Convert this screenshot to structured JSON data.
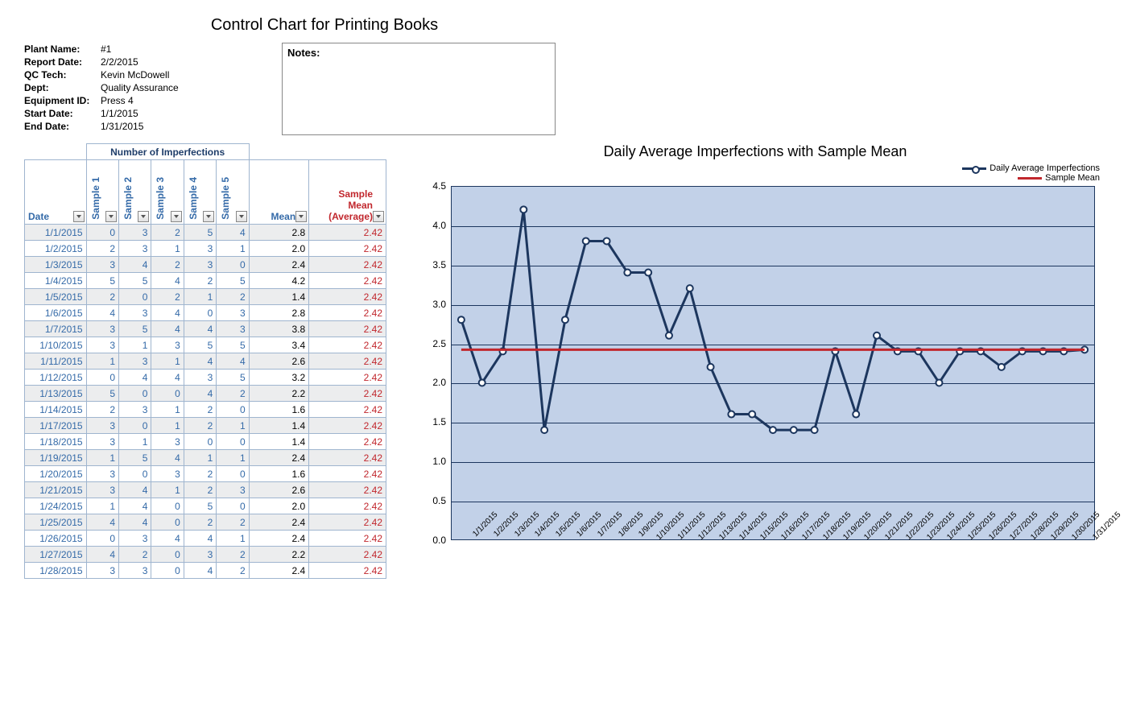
{
  "title": "Control Chart for Printing Books",
  "meta": [
    {
      "label": "Plant Name:",
      "value": "#1"
    },
    {
      "label": "Report Date:",
      "value": "2/2/2015"
    },
    {
      "label": "QC Tech:",
      "value": "Kevin McDowell"
    },
    {
      "label": "Dept:",
      "value": "Quality Assurance"
    },
    {
      "label": "Equipment ID:",
      "value": "Press 4"
    },
    {
      "label": "Start Date:",
      "value": "1/1/2015"
    },
    {
      "label": "End Date:",
      "value": "1/31/2015"
    }
  ],
  "notes_label": "Notes:",
  "table": {
    "imperf_header": "Number of Imperfections",
    "date_header": "Date",
    "sample_headers": [
      "Sample 1",
      "Sample 2",
      "Sample 3",
      "Sample 4",
      "Sample 5"
    ],
    "mean_header": "Mean",
    "sample_mean_header": "Sample Mean (Average)",
    "rows": [
      {
        "date": "1/1/2015",
        "s": [
          0,
          3,
          2,
          5,
          4
        ],
        "mean": "2.8",
        "smean": "2.42"
      },
      {
        "date": "1/2/2015",
        "s": [
          2,
          3,
          1,
          3,
          1
        ],
        "mean": "2.0",
        "smean": "2.42"
      },
      {
        "date": "1/3/2015",
        "s": [
          3,
          4,
          2,
          3,
          0
        ],
        "mean": "2.4",
        "smean": "2.42"
      },
      {
        "date": "1/4/2015",
        "s": [
          5,
          5,
          4,
          2,
          5
        ],
        "mean": "4.2",
        "smean": "2.42"
      },
      {
        "date": "1/5/2015",
        "s": [
          2,
          0,
          2,
          1,
          2
        ],
        "mean": "1.4",
        "smean": "2.42"
      },
      {
        "date": "1/6/2015",
        "s": [
          4,
          3,
          4,
          0,
          3
        ],
        "mean": "2.8",
        "smean": "2.42"
      },
      {
        "date": "1/7/2015",
        "s": [
          3,
          5,
          4,
          4,
          3
        ],
        "mean": "3.8",
        "smean": "2.42"
      },
      {
        "date": "1/10/2015",
        "s": [
          3,
          1,
          3,
          5,
          5
        ],
        "mean": "3.4",
        "smean": "2.42"
      },
      {
        "date": "1/11/2015",
        "s": [
          1,
          3,
          1,
          4,
          4
        ],
        "mean": "2.6",
        "smean": "2.42"
      },
      {
        "date": "1/12/2015",
        "s": [
          0,
          4,
          4,
          3,
          5
        ],
        "mean": "3.2",
        "smean": "2.42"
      },
      {
        "date": "1/13/2015",
        "s": [
          5,
          0,
          0,
          4,
          2
        ],
        "mean": "2.2",
        "smean": "2.42"
      },
      {
        "date": "1/14/2015",
        "s": [
          2,
          3,
          1,
          2,
          0
        ],
        "mean": "1.6",
        "smean": "2.42"
      },
      {
        "date": "1/17/2015",
        "s": [
          3,
          0,
          1,
          2,
          1
        ],
        "mean": "1.4",
        "smean": "2.42"
      },
      {
        "date": "1/18/2015",
        "s": [
          3,
          1,
          3,
          0,
          0
        ],
        "mean": "1.4",
        "smean": "2.42"
      },
      {
        "date": "1/19/2015",
        "s": [
          1,
          5,
          4,
          1,
          1
        ],
        "mean": "2.4",
        "smean": "2.42"
      },
      {
        "date": "1/20/2015",
        "s": [
          3,
          0,
          3,
          2,
          0
        ],
        "mean": "1.6",
        "smean": "2.42"
      },
      {
        "date": "1/21/2015",
        "s": [
          3,
          4,
          1,
          2,
          3
        ],
        "mean": "2.6",
        "smean": "2.42"
      },
      {
        "date": "1/24/2015",
        "s": [
          1,
          4,
          0,
          5,
          0
        ],
        "mean": "2.0",
        "smean": "2.42"
      },
      {
        "date": "1/25/2015",
        "s": [
          4,
          4,
          0,
          2,
          2
        ],
        "mean": "2.4",
        "smean": "2.42"
      },
      {
        "date": "1/26/2015",
        "s": [
          0,
          3,
          4,
          4,
          1
        ],
        "mean": "2.4",
        "smean": "2.42"
      },
      {
        "date": "1/27/2015",
        "s": [
          4,
          2,
          0,
          3,
          2
        ],
        "mean": "2.2",
        "smean": "2.42"
      },
      {
        "date": "1/28/2015",
        "s": [
          3,
          3,
          0,
          4,
          2
        ],
        "mean": "2.4",
        "smean": "2.42"
      }
    ]
  },
  "chart_data": {
    "type": "line",
    "title": "Daily Average Imperfections with Sample Mean",
    "xlabel": "",
    "ylabel": "",
    "ylim": [
      0.0,
      4.5
    ],
    "yticks": [
      0.0,
      0.5,
      1.0,
      1.5,
      2.0,
      2.5,
      3.0,
      3.5,
      4.0,
      4.5
    ],
    "categories": [
      "1/1/2015",
      "1/2/2015",
      "1/3/2015",
      "1/4/2015",
      "1/5/2015",
      "1/6/2015",
      "1/7/2015",
      "1/8/2015",
      "1/9/2015",
      "1/10/2015",
      "1/11/2015",
      "1/12/2015",
      "1/13/2015",
      "1/14/2015",
      "1/15/2015",
      "1/16/2015",
      "1/17/2015",
      "1/18/2015",
      "1/19/2015",
      "1/20/2015",
      "1/21/2015",
      "1/22/2015",
      "1/23/2015",
      "1/24/2015",
      "1/25/2015",
      "1/26/2015",
      "1/27/2015",
      "1/28/2015",
      "1/29/2015",
      "1/30/2015",
      "1/31/2015"
    ],
    "series": [
      {
        "name": "Daily Average Imperfections",
        "color": "#1c365e",
        "marker": true,
        "values": [
          2.8,
          2.0,
          2.4,
          4.2,
          1.4,
          2.8,
          3.8,
          3.8,
          3.4,
          3.4,
          2.6,
          3.2,
          2.2,
          1.6,
          1.6,
          1.4,
          1.4,
          1.4,
          2.4,
          1.6,
          2.6,
          2.4,
          2.4,
          2.0,
          2.4,
          2.4,
          2.2,
          2.4,
          2.4,
          2.4,
          2.42
        ]
      },
      {
        "name": "Sample Mean",
        "color": "#c1272d",
        "marker": false,
        "values": [
          2.42,
          2.42,
          2.42,
          2.42,
          2.42,
          2.42,
          2.42,
          2.42,
          2.42,
          2.42,
          2.42,
          2.42,
          2.42,
          2.42,
          2.42,
          2.42,
          2.42,
          2.42,
          2.42,
          2.42,
          2.42,
          2.42,
          2.42,
          2.42,
          2.42,
          2.42,
          2.42,
          2.42,
          2.42,
          2.42,
          2.42
        ]
      }
    ]
  }
}
